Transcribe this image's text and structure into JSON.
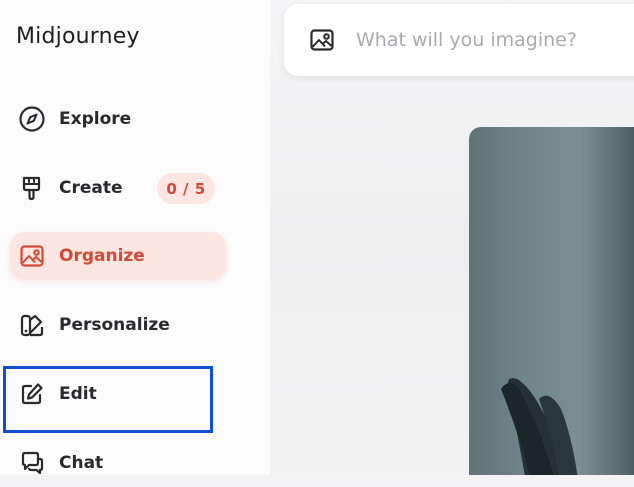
{
  "app": {
    "brand": "Midjourney"
  },
  "sidebar": {
    "items": [
      {
        "label": "Explore",
        "icon": "compass-icon"
      },
      {
        "label": "Create",
        "icon": "paintbrush-icon",
        "badge": "0 / 5"
      },
      {
        "label": "Organize",
        "icon": "image-gallery-icon",
        "active": true
      },
      {
        "label": "Personalize",
        "icon": "palette-icon"
      },
      {
        "label": "Edit",
        "icon": "edit-icon"
      },
      {
        "label": "Chat",
        "icon": "chat-icon"
      }
    ]
  },
  "search": {
    "placeholder": "What will you imagine?",
    "value": "",
    "icon": "image-icon"
  },
  "colors": {
    "accent": "#d24a35",
    "accent_bg": "#fde6e2",
    "highlight": "#0f4fd6",
    "sidebar_bg": "#fbfbfc"
  }
}
